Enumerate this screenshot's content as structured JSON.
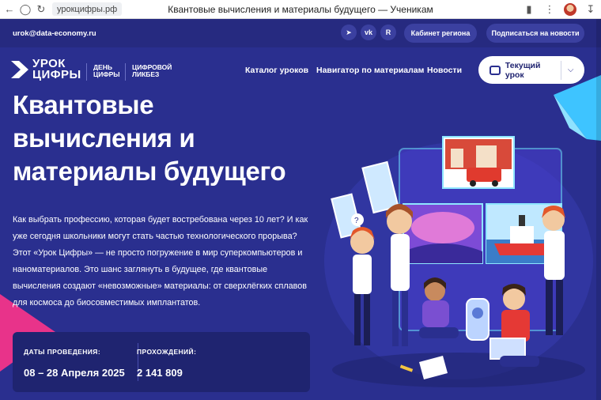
{
  "browser": {
    "url": "урокцифры.рф",
    "tab_title": "Квантовые вычисления и материалы будущего — Ученикам"
  },
  "topbar": {
    "email": "urok@data-economy.ru",
    "social": [
      "telegram",
      "vk",
      "rutube"
    ],
    "region_cabinet": "Кабинет региона",
    "subscribe": "Подписаться на новости"
  },
  "header": {
    "logo_line1": "УРОК",
    "logo_line2": "ЦИФРЫ",
    "sub1_line1": "ДЕНЬ",
    "sub1_line2": "ЦИФРЫ",
    "sub2_line1": "ЦИФРОВОЙ",
    "sub2_line2": "ЛИКБЕЗ",
    "nav": [
      "Каталог уроков",
      "Навигатор по материалам",
      "Новости"
    ],
    "current_lesson": "Текущий урок"
  },
  "hero": {
    "title_line1": "Квантовые",
    "title_line2": "вычисления и",
    "title_line3": "материалы будущего",
    "description": "Как выбрать профессию, которая будет востребована через 10 лет? И как уже сегодня школьники могут стать частью технологического прорыва? Этот «Урок Цифры» — не просто погружение в мир суперкомпьютеров и наноматериалов. Это шанс заглянуть в будущее, где квантовые вычисления создают «невозможные» материалы: от сверхлёгких сплавов для космоса до биосовместимых имплантатов."
  },
  "info": {
    "dates_label": "ДАТЫ ПРОВЕДЕНИЯ:",
    "dates_value": "08 – 28 Апреля 2025",
    "passes_label": "ПРОХОЖДЕНИЙ:",
    "passes_value": "2 141 809"
  },
  "colors": {
    "background": "#2a2f8f",
    "topbar": "#262a80",
    "accent_pink": "#e8338a",
    "accent_cyan": "#3ec4ff"
  }
}
